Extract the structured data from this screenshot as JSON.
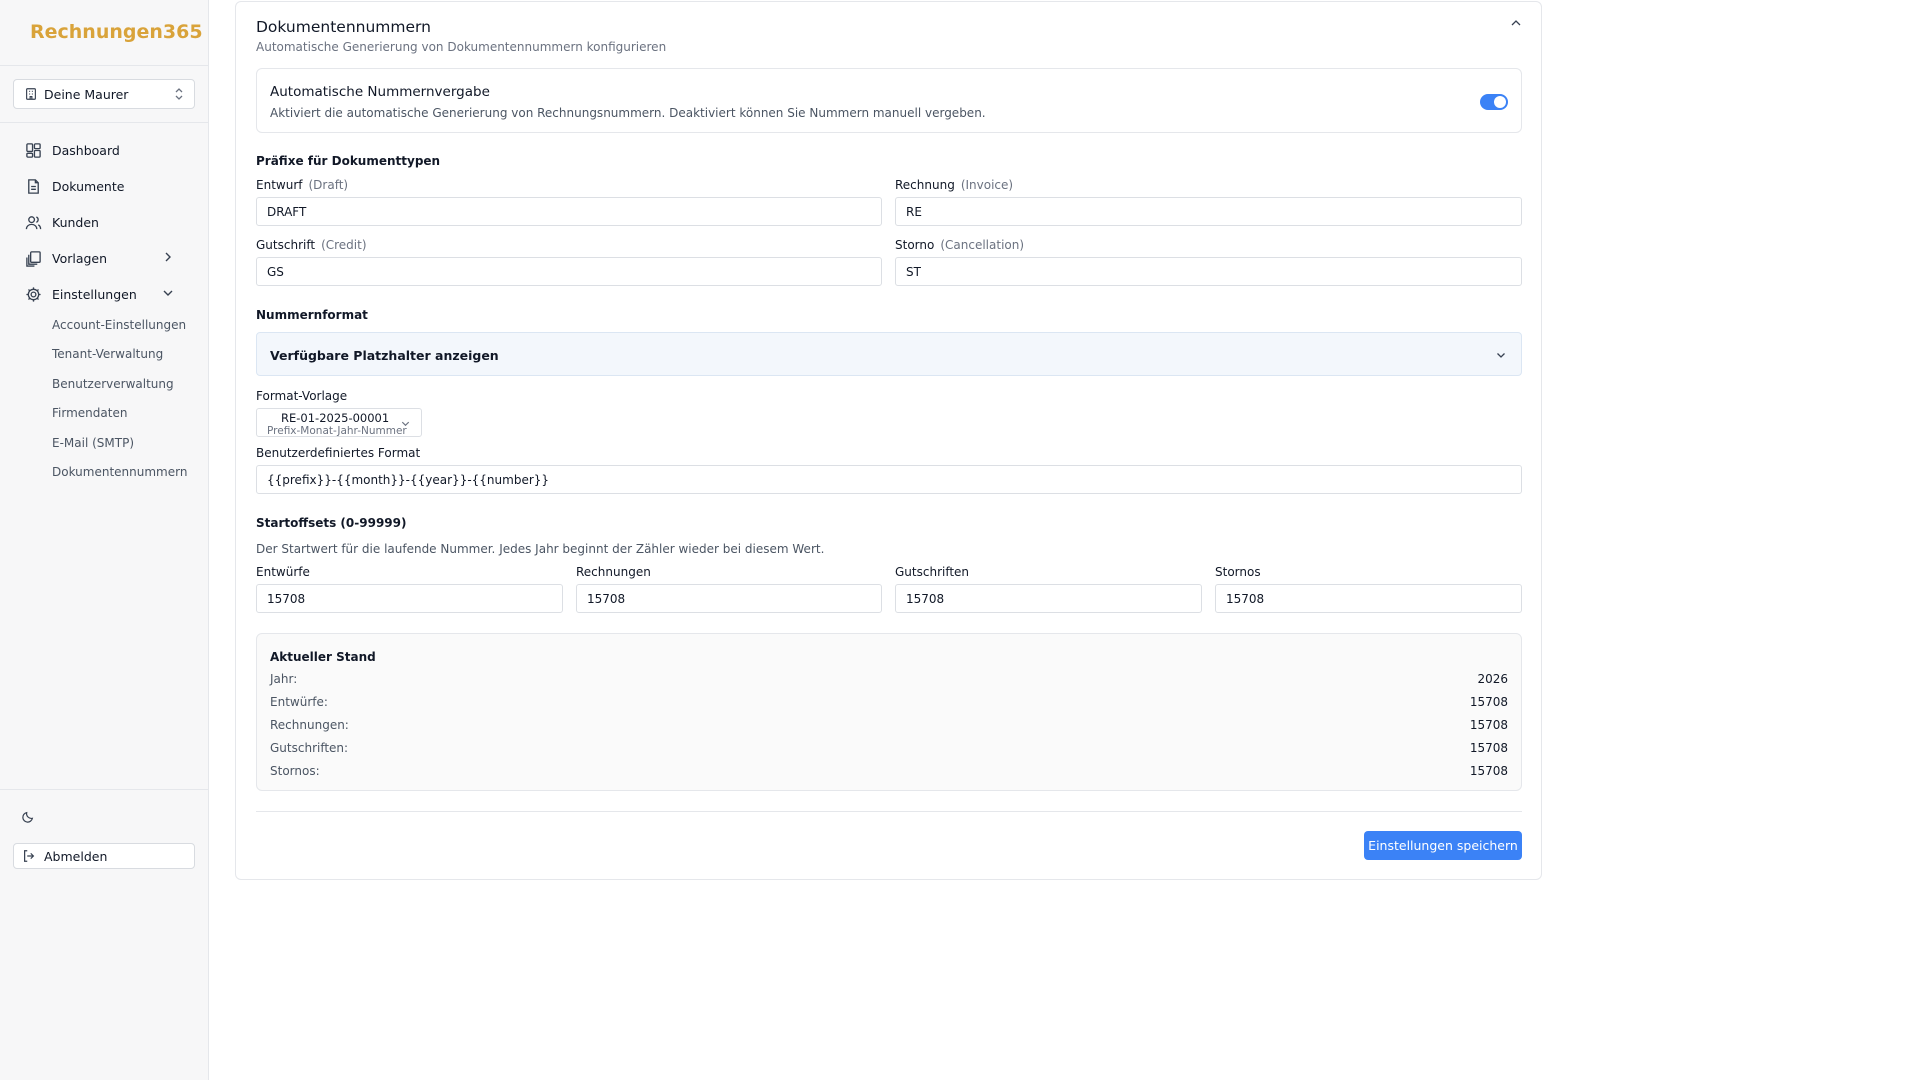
{
  "app": {
    "brand": "Rechnungen365"
  },
  "sidebar": {
    "tenant": {
      "label": "Deine Maurer",
      "icon": "building-icon"
    },
    "nav": [
      {
        "label": "Dashboard",
        "icon": "dashboard-icon"
      },
      {
        "label": "Dokumente",
        "icon": "document-icon"
      },
      {
        "label": "Kunden",
        "icon": "users-icon"
      },
      {
        "label": "Vorlagen",
        "icon": "templates-icon",
        "expanded": false
      },
      {
        "label": "Einstellungen",
        "icon": "gear-icon",
        "expanded": true
      }
    ],
    "settings_items": [
      "Account-Einstellungen",
      "Tenant-Verwaltung",
      "Benutzerverwaltung",
      "Firmendaten",
      "E-Mail (SMTP)",
      "Dokumentennummern"
    ],
    "logout_label": "Abmelden"
  },
  "card": {
    "title": "Dokumentennummern",
    "subtitle": "Automatische Generierung von Dokumentennummern konfigurieren",
    "auto_numbering": {
      "title": "Automatische Nummernvergabe",
      "description": "Aktiviert die automatische Generierung von Rechnungsnummern. Deaktiviert können Sie Nummern manuell vergeben.",
      "enabled": true
    },
    "prefixes": {
      "heading": "Präfixe für Dokumenttypen",
      "draft": {
        "label": "Entwurf",
        "hint": "(Draft)",
        "value": "DRAFT"
      },
      "invoice": {
        "label": "Rechnung",
        "hint": "(Invoice)",
        "value": "RE"
      },
      "credit": {
        "label": "Gutschrift",
        "hint": "(Credit)",
        "value": "GS"
      },
      "cancellation": {
        "label": "Storno",
        "hint": "(Cancellation)",
        "value": "ST"
      }
    },
    "number_format": {
      "heading": "Nummernformat",
      "placeholders_toggle": "Verfügbare Platzhalter anzeigen",
      "template_label": "Format-Vorlage",
      "template_value": "RE-01-2025-00001",
      "template_sub": "Prefix-Monat-Jahr-Nummer",
      "custom_label": "Benutzerdefiniertes Format",
      "custom_value": "{{prefix}}-{{month}}-{{year}}-{{number}}"
    },
    "offsets": {
      "heading": "Startoffsets (0-99999)",
      "description": "Der Startwert für die laufende Nummer. Jedes Jahr beginnt der Zähler wieder bei diesem Wert.",
      "fields": [
        {
          "label": "Entwürfe",
          "value": "15708"
        },
        {
          "label": "Rechnungen",
          "value": "15708"
        },
        {
          "label": "Gutschriften",
          "value": "15708"
        },
        {
          "label": "Stornos",
          "value": "15708"
        }
      ]
    },
    "status": {
      "heading": "Aktueller Stand",
      "rows": [
        {
          "label": "Jahr:",
          "value": "2026"
        },
        {
          "label": "Entwürfe:",
          "value": "15708"
        },
        {
          "label": "Rechnungen:",
          "value": "15708"
        },
        {
          "label": "Gutschriften:",
          "value": "15708"
        },
        {
          "label": "Stornos:",
          "value": "15708"
        }
      ]
    },
    "save_label": "Einstellungen speichern"
  },
  "colors": {
    "brand": "#d9a33a",
    "primary": "#3b82f6"
  }
}
